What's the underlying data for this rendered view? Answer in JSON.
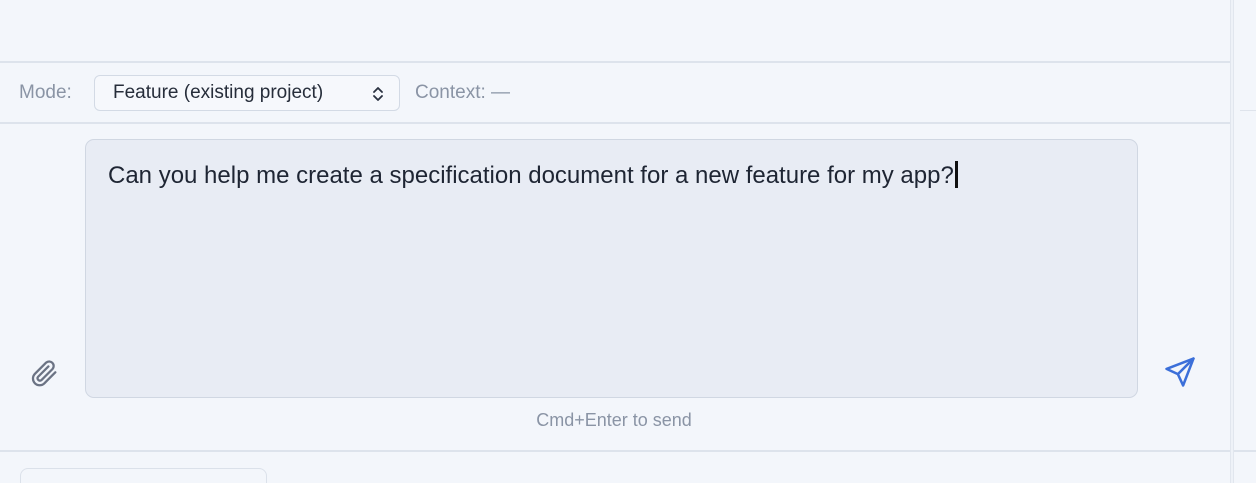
{
  "mode": {
    "label": "Mode:",
    "selected": "Feature (existing project)"
  },
  "context": {
    "text": "Context: —"
  },
  "composer": {
    "text": "Can you help me create a specification document for a new feature for my app?"
  },
  "hint": "Cmd+Enter to send",
  "icons": {
    "attach": "paperclip-icon",
    "send": "send-icon",
    "select": "chevron-up-down-icon"
  },
  "colors": {
    "accent": "#3b6fd9",
    "muted_text": "#8a94a5",
    "body_text": "#1e2533"
  }
}
